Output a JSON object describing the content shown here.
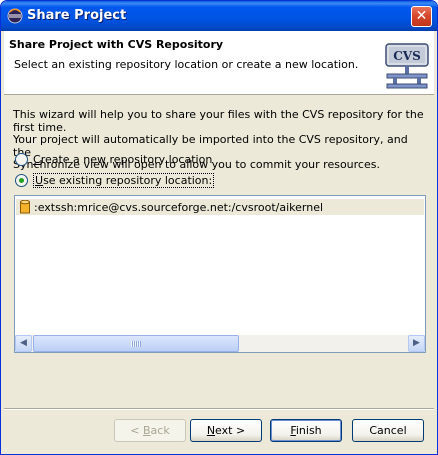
{
  "window": {
    "title": "Share Project",
    "close_glyph": "✕"
  },
  "banner": {
    "title": "Share Project with CVS Repository",
    "description": "Select an existing repository location or create a new location.",
    "graphic_label": "CVS"
  },
  "body": {
    "description_lines": [
      "This wizard will help you to share your files with the CVS repository for the first time.",
      "Your project will automatically be imported into the CVS repository, and the",
      "Synchronize view will open to allow you to commit your resources."
    ],
    "options": [
      {
        "label_accel": "C",
        "label_rest": "reate a new repository location",
        "checked": false
      },
      {
        "label_accel": "U",
        "label_rest": "se existing repository location:",
        "checked": true
      }
    ],
    "repositories": [
      ":extssh:mrice@cvs.sourceforge.net:/cvsroot/aikernel"
    ]
  },
  "buttons": {
    "back": {
      "prefix": "< ",
      "accel": "B",
      "rest": "ack",
      "enabled": false
    },
    "next": {
      "accel": "N",
      "rest": "ext >",
      "enabled": true
    },
    "finish": {
      "accel": "F",
      "rest": "inish",
      "enabled": true
    },
    "cancel": {
      "label": "Cancel",
      "enabled": true
    }
  },
  "colors": {
    "titlebar": "#0054e3",
    "dialog_bg": "#ece9d8",
    "selection_bg": "#ece9d8"
  },
  "icons": {
    "title": "eclipse-icon",
    "repository": "database-icon",
    "banner": "cvs-repository-icon"
  }
}
